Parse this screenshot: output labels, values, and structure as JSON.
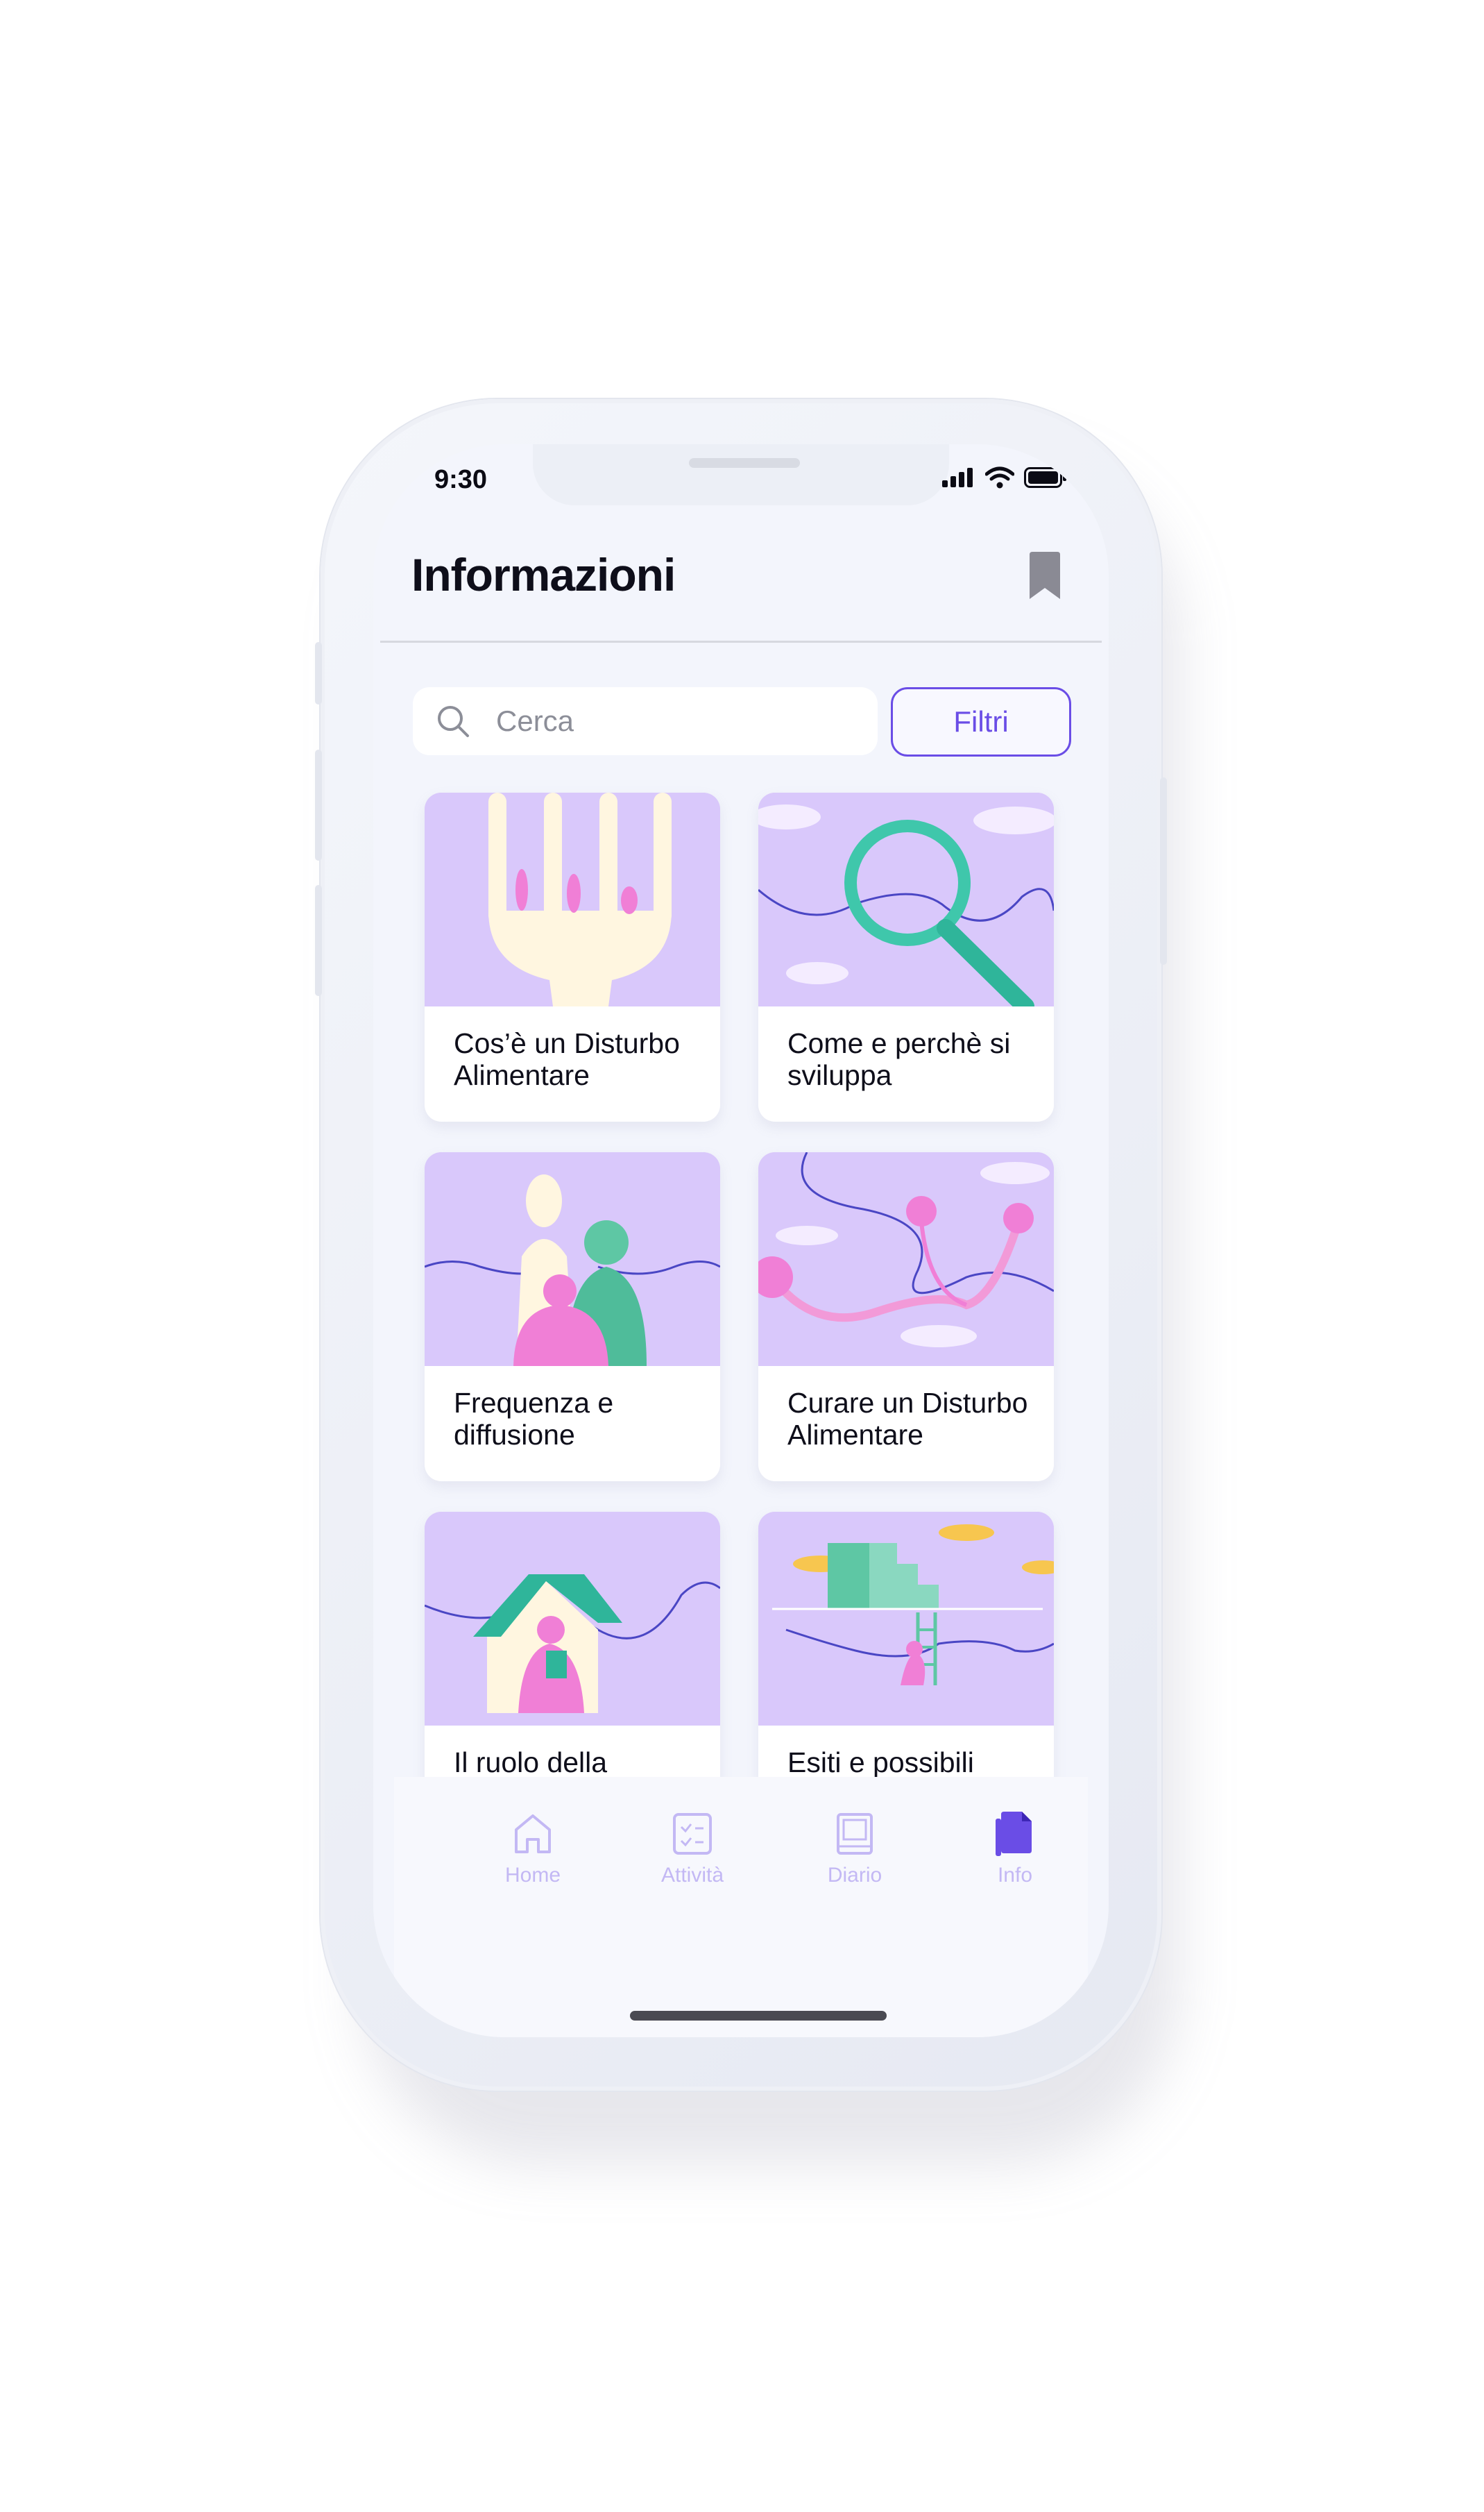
{
  "status": {
    "time": "9:30"
  },
  "header": {
    "title": "Informazioni"
  },
  "search": {
    "placeholder": "Cerca"
  },
  "filter": {
    "label": "Filtri"
  },
  "cards": [
    {
      "title": "Cos’è un Disturbo Alimentare",
      "art": "fork-illustration"
    },
    {
      "title": "Come e perchè si sviluppa",
      "art": "magnifier-illustration"
    },
    {
      "title": "Frequenza e diffusione",
      "art": "people-illustration"
    },
    {
      "title": "Curare un Disturbo Alimentare",
      "art": "stethoscope-illustration"
    },
    {
      "title": "Il ruolo della famiglia",
      "art": "house-illustration"
    },
    {
      "title": "Esiti e possibili complicazioni",
      "art": "stairs-illustration"
    }
  ],
  "tabs": [
    {
      "label": "Home",
      "icon": "home-icon",
      "active": false
    },
    {
      "label": "Attività",
      "icon": "checklist-icon",
      "active": false
    },
    {
      "label": "Diario",
      "icon": "book-icon",
      "active": false
    },
    {
      "label": "Info",
      "icon": "document-icon",
      "active": true
    }
  ],
  "colors": {
    "accent": "#6a4de6",
    "card_art_bg": "#d9c8fb",
    "screen_bg": "#f3f5fc"
  }
}
